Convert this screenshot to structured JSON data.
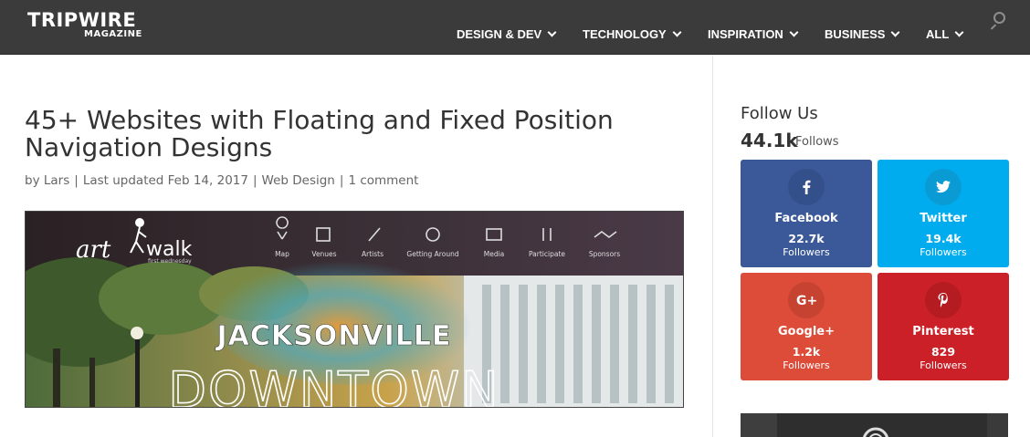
{
  "header": {
    "logo_top": "TRIPWIRE",
    "logo_bottom": "MAGAZINE",
    "nav": [
      {
        "label": "DESIGN & DEV"
      },
      {
        "label": "TECHNOLOGY"
      },
      {
        "label": "INSPIRATION"
      },
      {
        "label": "BUSINESS"
      },
      {
        "label": "ALL"
      }
    ],
    "search_icon": "search-icon"
  },
  "article": {
    "title": "45+ Websites with Floating and Fixed Position Navigation Designs",
    "meta": {
      "by": "by",
      "author": "Lars",
      "updated": "Last updated Feb 14, 2017",
      "category": "Web Design",
      "comments": "1 comment"
    },
    "hero": {
      "logo_text_art": "art",
      "logo_text_walk": "walk",
      "logo_sub": "first wednesday",
      "menu": [
        "Map",
        "Venues",
        "Artists",
        "Getting Around",
        "Media",
        "Participate",
        "Sponsors"
      ],
      "headline_1": "JACKSONVILLE",
      "headline_2": "DOWNTOWN"
    }
  },
  "sidebar": {
    "follow_title": "Follow Us",
    "follow_count": "44.1k",
    "follow_label": "Follows",
    "social": [
      {
        "name": "Facebook",
        "count": "22.7k",
        "label": "Followers",
        "color": "#3b5998",
        "circle": "#34508a",
        "icon": "facebook-icon"
      },
      {
        "name": "Twitter",
        "count": "19.4k",
        "label": "Followers",
        "color": "#00aced",
        "circle": "#0a9bd4",
        "icon": "twitter-icon"
      },
      {
        "name": "Google+",
        "count": "1.2k",
        "label": "Followers",
        "color": "#dd4b39",
        "circle": "#c64332",
        "icon": "google-plus-icon"
      },
      {
        "name": "Pinterest",
        "count": "829",
        "label": "Followers",
        "color": "#cb2027",
        "circle": "#b41c22",
        "icon": "pinterest-icon"
      }
    ]
  }
}
